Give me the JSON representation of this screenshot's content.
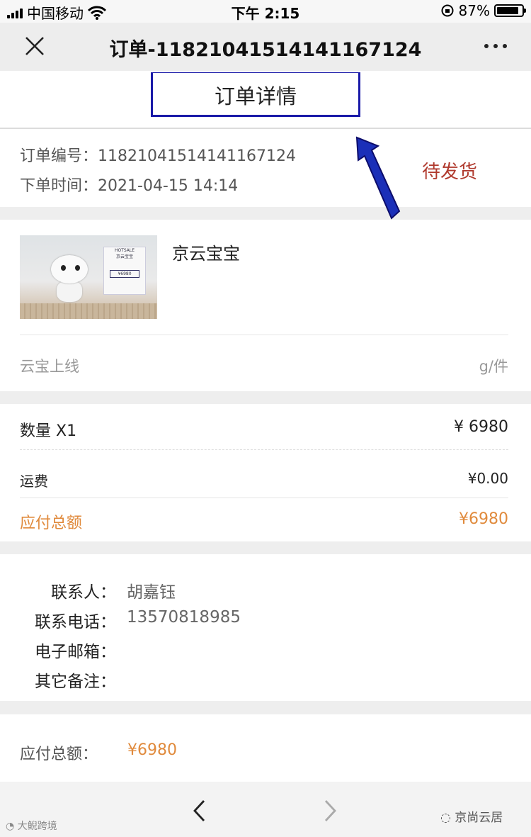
{
  "status_bar": {
    "carrier": "中国移动",
    "time": "下午 2:15",
    "battery": "87%"
  },
  "nav": {
    "title": "订单-1182104151414116​7124"
  },
  "header": {
    "tab_title": "订单详情"
  },
  "order_info": {
    "number_label": "订单编号：",
    "number_value": "118210415141411671​24",
    "time_label": "下单时间：",
    "time_value": "2021-04-15 14:14",
    "status": "待发货"
  },
  "product": {
    "name": "京云宝宝",
    "spec_left": "云宝上线",
    "spec_right": "g/件",
    "thumb_text": {
      "brand": "HOTSALE",
      "name": "京云宝宝",
      "price": "¥6980"
    }
  },
  "pricing": {
    "qty_label": "数量 X1",
    "qty_value": "¥  6980",
    "shipping_label": "运费",
    "shipping_value": "¥0.00",
    "due_label": "应付总额",
    "due_value": "¥6980"
  },
  "contact": {
    "person_label": "联系人：",
    "person_value": "胡嘉钰",
    "phone_label": "联系电话：",
    "phone_value": "13570818985",
    "email_label": "电子邮箱：",
    "email_value": "",
    "note_label": "其它备注：",
    "note_value": ""
  },
  "total": {
    "label": "应付总额：",
    "value": "¥6980"
  },
  "watermarks": {
    "left": "大鲵跨境",
    "right": "京尚云居"
  }
}
